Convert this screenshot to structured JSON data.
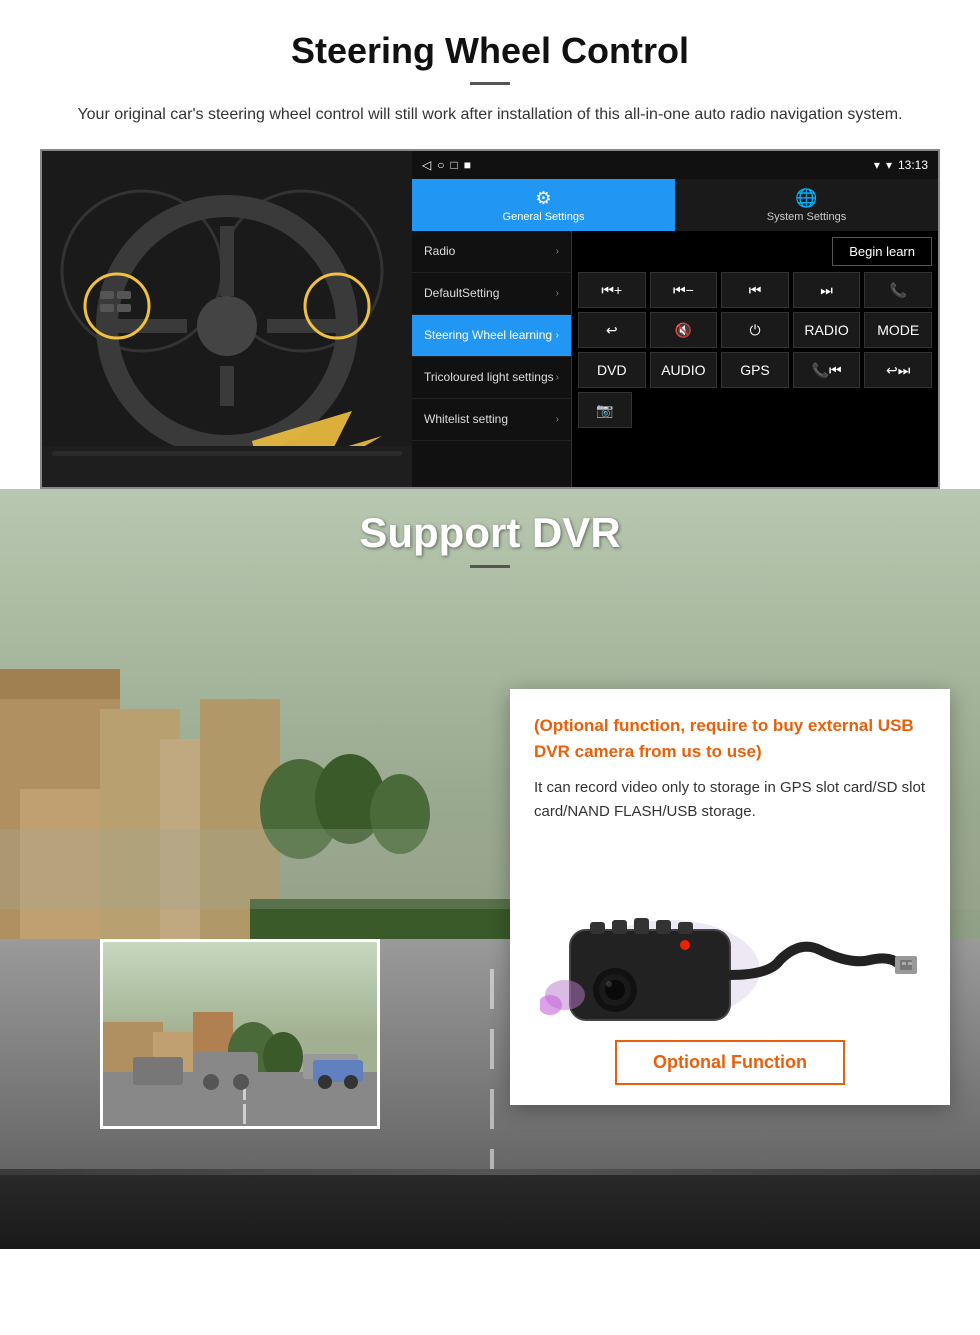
{
  "page": {
    "steering_section": {
      "title": "Steering Wheel Control",
      "subtitle": "Your original car's steering wheel control will still work after installation of this all-in-one auto radio navigation system."
    },
    "android_ui": {
      "statusbar": {
        "time": "13:13",
        "signal_icon": "▾",
        "wifi_icon": "▾"
      },
      "nav_icons": [
        "◁",
        "○",
        "□",
        "■"
      ],
      "tabs": [
        {
          "label": "General Settings",
          "icon": "⚙",
          "active": true
        },
        {
          "label": "System Settings",
          "icon": "🌐",
          "active": false
        }
      ],
      "menu_items": [
        {
          "label": "Radio",
          "active": false
        },
        {
          "label": "DefaultSetting",
          "active": false
        },
        {
          "label": "Steering Wheel learning",
          "active": true
        },
        {
          "label": "Tricoloured light settings",
          "active": false
        },
        {
          "label": "Whitelist setting",
          "active": false
        }
      ],
      "begin_learn_label": "Begin learn",
      "control_buttons_row1": [
        "⏮+",
        "⏮−",
        "⏮",
        "⏭",
        "📞"
      ],
      "control_buttons_row2": [
        "↩",
        "🔇",
        "⏻",
        "RADIO",
        "MODE"
      ],
      "control_buttons_row3": [
        "DVD",
        "AUDIO",
        "GPS",
        "📞⏮",
        "↩⏭"
      ],
      "control_buttons_row4": [
        "📷"
      ]
    },
    "dvr_section": {
      "title": "Support DVR",
      "optional_text": "(Optional function, require to buy external USB DVR camera from us to use)",
      "desc_text": "It can record video only to storage in GPS slot card/SD slot card/NAND FLASH/USB storage.",
      "optional_function_label": "Optional Function"
    }
  }
}
